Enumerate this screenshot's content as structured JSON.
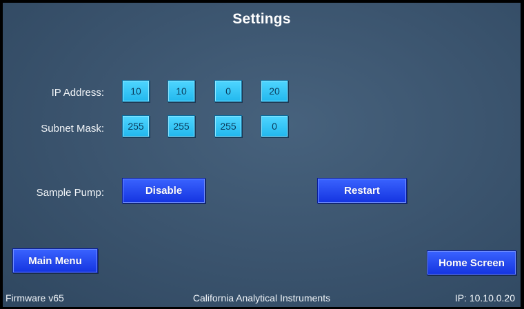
{
  "title": "Settings",
  "ip_address": {
    "label": "IP Address:",
    "octets": [
      "10",
      "10",
      "0",
      "20"
    ]
  },
  "subnet_mask": {
    "label": "Subnet Mask:",
    "octets": [
      "255",
      "255",
      "255",
      "0"
    ]
  },
  "sample_pump": {
    "label": "Sample Pump:",
    "button": "Disable"
  },
  "buttons": {
    "restart": "Restart",
    "main_menu": "Main Menu",
    "home_screen": "Home Screen"
  },
  "footer": {
    "firmware": "Firmware v65",
    "company": "California Analytical Instruments",
    "ip": "IP: 10.10.0.20"
  },
  "colors": {
    "background": "#3a536d",
    "octet_field": "#2bc3f4",
    "button": "#1e40f0"
  }
}
